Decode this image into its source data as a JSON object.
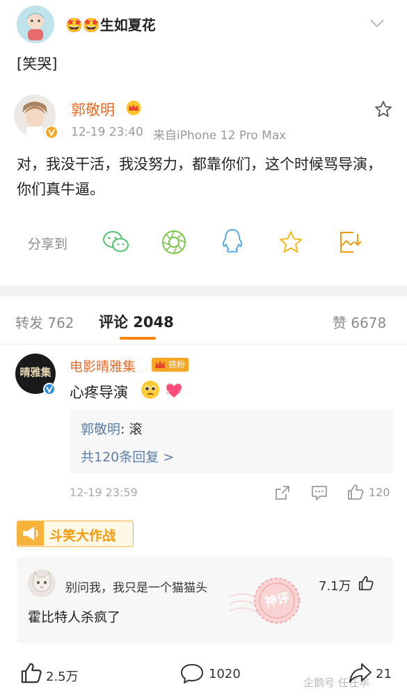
{
  "repost_user": {
    "name": "🤩🤩生如夏花",
    "text": "[笑哭]"
  },
  "original_post": {
    "author": "郭敬明",
    "time": "12-19 23:40",
    "source": "来自iPhone 12 Pro Max",
    "content": "对，我没干活，我没努力，都靠你们，这个时候骂导演，你们真牛逼。"
  },
  "share_bar": {
    "label": "分享到"
  },
  "tabs": {
    "repost": "转发 762",
    "comments": "评论 2048",
    "likes": "赞 6678"
  },
  "comment": {
    "author": "电影晴雅集",
    "fan_badge": "铁粉",
    "text": "心疼导演",
    "avatar_text": "晴雅集",
    "reply": {
      "author": "郭敬明",
      "text": ": 滚",
      "more": "共120条回复 >"
    },
    "time": "12-19 23:59",
    "like_count": "120"
  },
  "event": {
    "label": "斗笑大作战"
  },
  "god_comment": {
    "author": "别问我，我只是一个猫猫头",
    "likes": "7.1万",
    "text": "霍比特人杀疯了",
    "stamp": "神评"
  },
  "footer": {
    "likes": "2.5万",
    "comments": "1020",
    "shares": "21",
    "watermark": "企鹅号 任任乖"
  }
}
